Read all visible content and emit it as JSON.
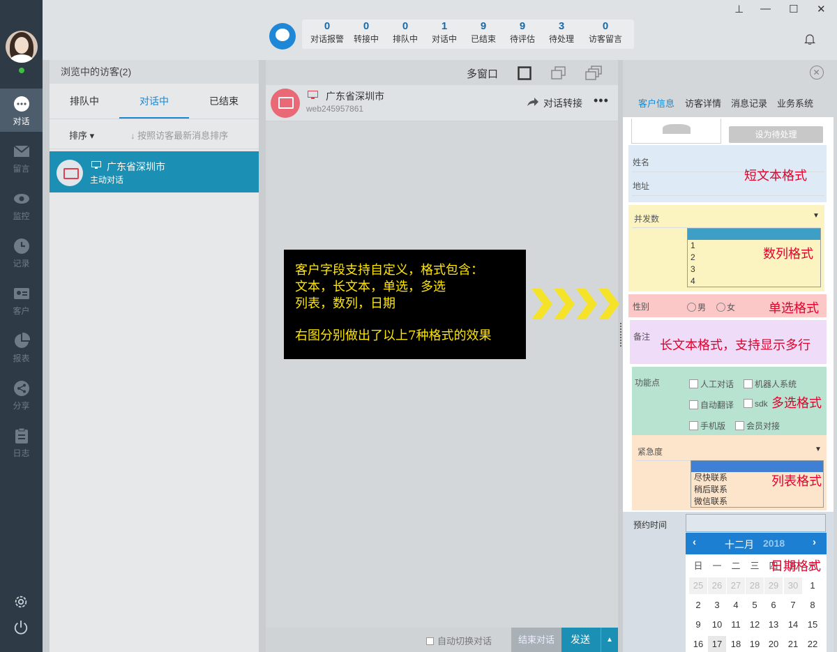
{
  "nav": {
    "items": [
      {
        "id": "chat",
        "label": "对话",
        "active": true
      },
      {
        "id": "message",
        "label": "留言"
      },
      {
        "id": "monitor",
        "label": "监控"
      },
      {
        "id": "record",
        "label": "记录"
      },
      {
        "id": "customer",
        "label": "客户"
      },
      {
        "id": "report",
        "label": "报表"
      },
      {
        "id": "share",
        "label": "分享"
      },
      {
        "id": "log",
        "label": "日志"
      }
    ]
  },
  "stats": [
    {
      "num": "0",
      "label": "对话报警"
    },
    {
      "num": "0",
      "label": "转接中"
    },
    {
      "num": "0",
      "label": "排队中"
    },
    {
      "num": "1",
      "label": "对话中"
    },
    {
      "num": "9",
      "label": "已结束"
    },
    {
      "num": "9",
      "label": "待评估"
    },
    {
      "num": "3",
      "label": "待处理"
    },
    {
      "num": "0",
      "label": "访客留言"
    }
  ],
  "visitors": {
    "title": "浏览中的访客(2)",
    "tabs": [
      "排队中",
      "对话中",
      "已结束"
    ],
    "sort_label": "排序 ▾",
    "sort_hint": "↓ 按照访客最新消息排序",
    "item": {
      "location": "广东省深圳市",
      "status": "主动对话"
    }
  },
  "chat": {
    "multi_window": "多窗口",
    "location": "广东省深圳市",
    "visitor_id": "web245957861",
    "transfer": "对话转接",
    "more": "•••",
    "auto_switch": "自动切换对话",
    "end_button": "结束对话",
    "send_button": "发送"
  },
  "right": {
    "tabs": [
      "客户信息",
      "访客详情",
      "消息记录",
      "业务系统"
    ],
    "set_pending": "设为待处理",
    "fields": {
      "name": "姓名",
      "address": "地址",
      "concurrency": "并发数",
      "gender": "性别",
      "male": "男",
      "female": "女",
      "remark": "备注",
      "features": "功能点",
      "urgency": "紧急度",
      "appointment": "预约时间"
    },
    "number_options": [
      "1",
      "2",
      "3",
      "4"
    ],
    "feature_options": [
      "人工对话",
      "机器人系统",
      "自动翻译",
      "sdk",
      "手机版",
      "会员对接"
    ],
    "urgency_options": [
      "尽快联系",
      "稍后联系",
      "微信联系"
    ],
    "format_tags": {
      "short_text": "短文本格式",
      "number_list": "数列格式",
      "single_choice": "单选格式",
      "long_text": "长文本格式，支持显示多行",
      "multi_choice": "多选格式",
      "list": "列表格式",
      "date": "日期格式"
    },
    "calendar": {
      "month": "十二月",
      "year": "2018",
      "weekdays": [
        "日",
        "一",
        "二",
        "三",
        "四",
        "五",
        "六"
      ],
      "row1": [
        "25",
        "26",
        "27",
        "28",
        "29",
        "30",
        "1"
      ],
      "row2": [
        "2",
        "3",
        "4",
        "5",
        "6",
        "7",
        "8"
      ],
      "row3": [
        "9",
        "10",
        "11",
        "12",
        "13",
        "14",
        "15"
      ],
      "row4": [
        "16",
        "17",
        "18",
        "19",
        "20",
        "21",
        "22"
      ]
    }
  },
  "annotation": {
    "line1": "客户字段支持自定义，格式包含：",
    "line2": "文本，长文本，单选，多选",
    "line3": "列表，数列，日期",
    "line4": "右图分别做出了以上7种格式的效果"
  },
  "colors": {
    "nav_bg": "#2e3a46",
    "accent": "#1c8fb5",
    "tag_red": "#e4002b",
    "annotation_yellow": "#ffe600"
  }
}
